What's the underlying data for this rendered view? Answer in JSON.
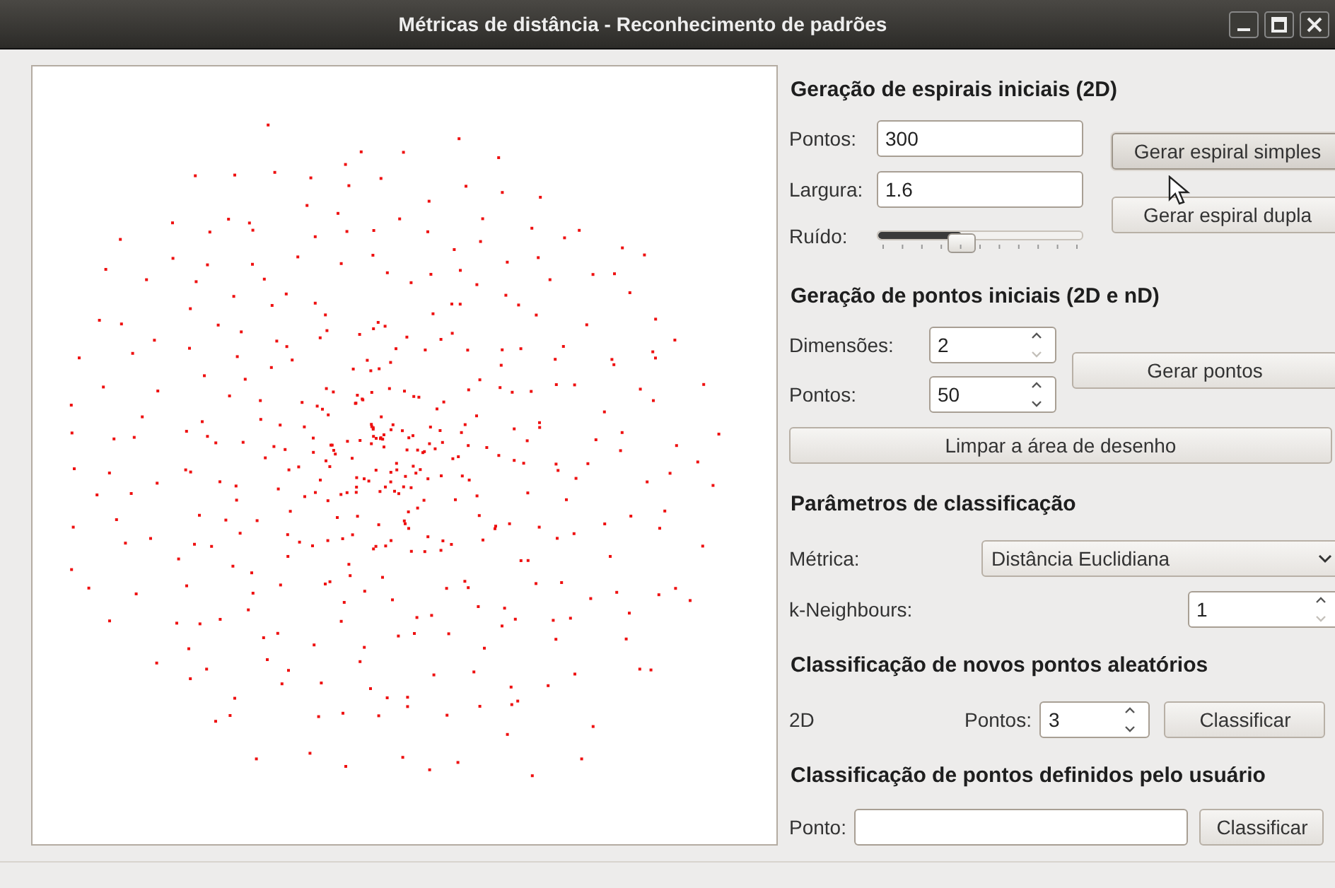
{
  "window": {
    "title": "Métricas de distância - Reconhecimento de padrões"
  },
  "spiral_section": {
    "heading": "Geração de espirais iniciais (2D)",
    "fields": [
      {
        "label": "Pontos:",
        "value": "300"
      },
      {
        "label": "Largura:",
        "value": "1.6"
      }
    ],
    "noise": {
      "label": "Ruído:",
      "level": 0.41
    },
    "buttons": [
      {
        "label": "Gerar espiral simples",
        "hovered": true
      },
      {
        "label": "Gerar espiral dupla",
        "hovered": false
      }
    ]
  },
  "points_section": {
    "heading": "Geração de pontos iniciais (2D e nD)",
    "spinboxes": [
      {
        "label": "Dimensões:",
        "value": "2",
        "down_enabled": false
      },
      {
        "label": "Pontos:",
        "value": "50",
        "down_enabled": true
      }
    ],
    "button": "Gerar pontos",
    "clear_button": "Limpar a área de desenho"
  },
  "classification": {
    "heading": "Parâmetros de classificação",
    "metric": {
      "label": "Métrica:",
      "value": "Distância Euclidiana"
    },
    "neighbours": {
      "label": "k-Neighbours:",
      "value": "1",
      "down_enabled": false
    }
  },
  "random_section": {
    "heading": "Classificação de novos pontos aleatórios",
    "dimension": "2D",
    "points": {
      "label": "Pontos:",
      "value": "3",
      "down_enabled": true
    },
    "button": "Classificar"
  },
  "user_section": {
    "heading": "Classificação de pontos definidos pelo usuário",
    "point": {
      "label": "Ponto:"
    },
    "button": "Classificar"
  }
}
